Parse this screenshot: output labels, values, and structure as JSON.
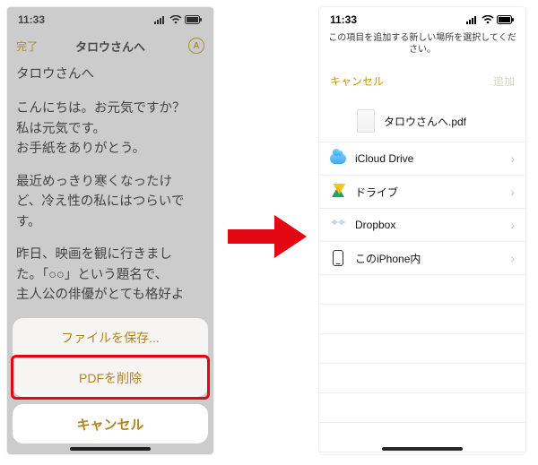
{
  "left": {
    "status": {
      "time": "11:33"
    },
    "nav": {
      "done": "完了",
      "title": "タロウさんへ",
      "right_glyph": "A"
    },
    "note": {
      "greeting": "タロウさんへ",
      "p1_l1": "こんにちは。お元気ですか？",
      "p1_l2": "私は元気です。",
      "p1_l3": "お手紙をありがとう。",
      "p2_l1": "最近めっきり寒くなったけ",
      "p2_l2": "ど、冷え性の私にはつらいで",
      "p2_l3": "す。",
      "p3_l1": "昨日、映画を観に行きまし",
      "p3_l2": "た。「○○」という題名で、",
      "p3_l3": "主人公の俳優がとても格好よ"
    },
    "sheet": {
      "save": "ファイルを保存...",
      "delete": "PDFを削除",
      "cancel": "キャンセル"
    }
  },
  "right": {
    "status": {
      "time": "11:33"
    },
    "prompt": "この項目を追加する新しい場所を選択してください。",
    "cancel": "キャンセル",
    "add": "追加",
    "file": "タロウさんへ.pdf",
    "locations": [
      {
        "label": "iCloud Drive",
        "icon": "icloud"
      },
      {
        "label": "ドライブ",
        "icon": "gdrive"
      },
      {
        "label": "Dropbox",
        "icon": "dropbox"
      },
      {
        "label": "このiPhone内",
        "icon": "iphone"
      }
    ]
  }
}
